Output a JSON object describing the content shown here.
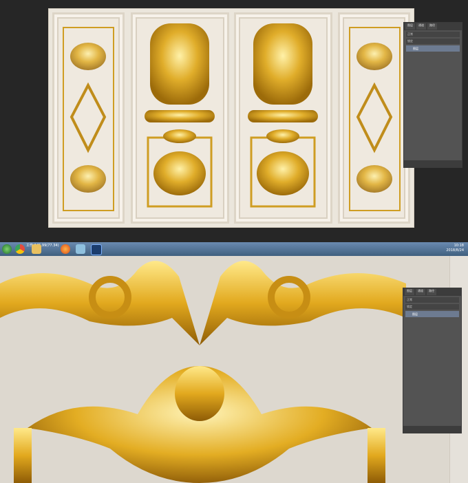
{
  "photoshop_panel": {
    "tabs": [
      "图层",
      "通道",
      "路径"
    ],
    "rows": [
      "正常",
      "锁定"
    ],
    "layer_label": "图层"
  },
  "taskbar": {
    "label": "工作-145.99(77.34)",
    "clock_time": "10:18",
    "clock_date": "2018/8/24"
  },
  "colors": {
    "gold": "#d4a017",
    "gold_dark": "#a0710b",
    "panel_bg": "#535353",
    "taskbar": "#4e6f94"
  },
  "icons": [
    "start-icon",
    "chrome-icon",
    "folder-icon",
    "firefox-icon",
    "image-viewer-icon",
    "photoshop-icon"
  ]
}
